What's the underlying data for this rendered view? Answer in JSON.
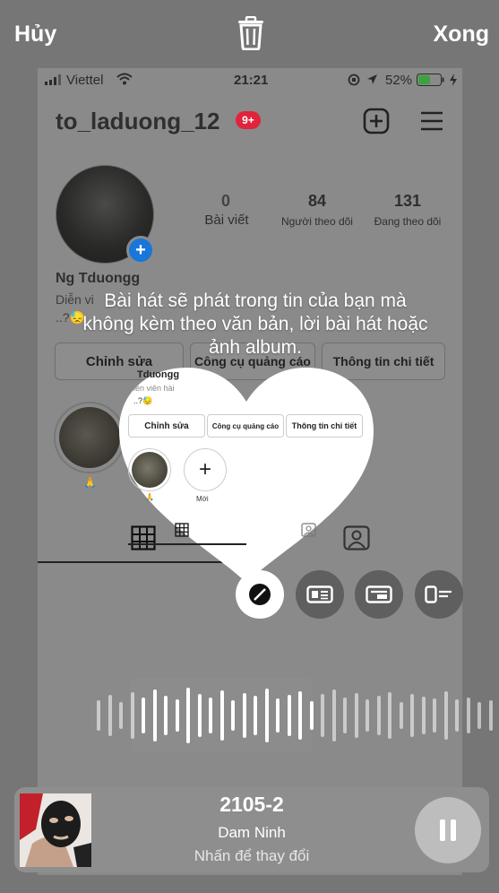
{
  "topbar": {
    "cancel": "Hủy",
    "done": "Xong",
    "delete_icon": "trash-icon"
  },
  "status_bar": {
    "carrier": "Viettel",
    "time": "21:21",
    "battery": "52%"
  },
  "profile": {
    "username": "to_laduong_12",
    "notification_badge": "9+",
    "posts_count": "0",
    "posts_label": "Bài viết",
    "followers_count": "84",
    "followers_label": "Người theo dõi",
    "following_count": "131",
    "following_label": "Đang theo dõi",
    "display_name": "Ng Tduongg",
    "bio_line1": "Diễn viên hài",
    "bio_line2": "..?😓",
    "buttons": {
      "edit": "Chỉnh sửa",
      "tools": "Công cụ quảng cáo",
      "info": "Thông tin chi tiết"
    },
    "highlight_caption": "🙏",
    "new_highlight_label": "Mới"
  },
  "sticker_hint": "Bài hát sẽ phát trong tin của bạn mà không kèm theo văn bản, lời bài hát hoặc ảnh album.",
  "heart_preview": {
    "name_fragment": "Tduongg",
    "bio_fragment": "iễn viên hài",
    "bio_line2": "..?😓",
    "buttons": {
      "edit": "Chỉnh sửa",
      "tools": "Công cụ quảng cáo",
      "info": "Thông tin chi tiết"
    },
    "highlight_caption": "🙏",
    "new_label": "Mới"
  },
  "waveform": {
    "bar_heights": [
      34,
      46,
      30,
      52,
      40,
      58,
      44,
      36,
      62,
      48,
      40,
      56,
      34,
      50,
      44,
      60,
      38,
      46,
      54,
      32,
      48,
      58,
      40,
      50,
      36,
      44,
      52,
      30,
      48,
      42,
      38,
      54,
      36,
      40,
      30,
      34
    ]
  },
  "now_playing": {
    "title": "2105-2",
    "artist": "Dam Ninh",
    "hint": "Nhấn để thay đổi"
  },
  "colors": {
    "badge": "#e0243c",
    "plus_blue": "#1877d8"
  }
}
